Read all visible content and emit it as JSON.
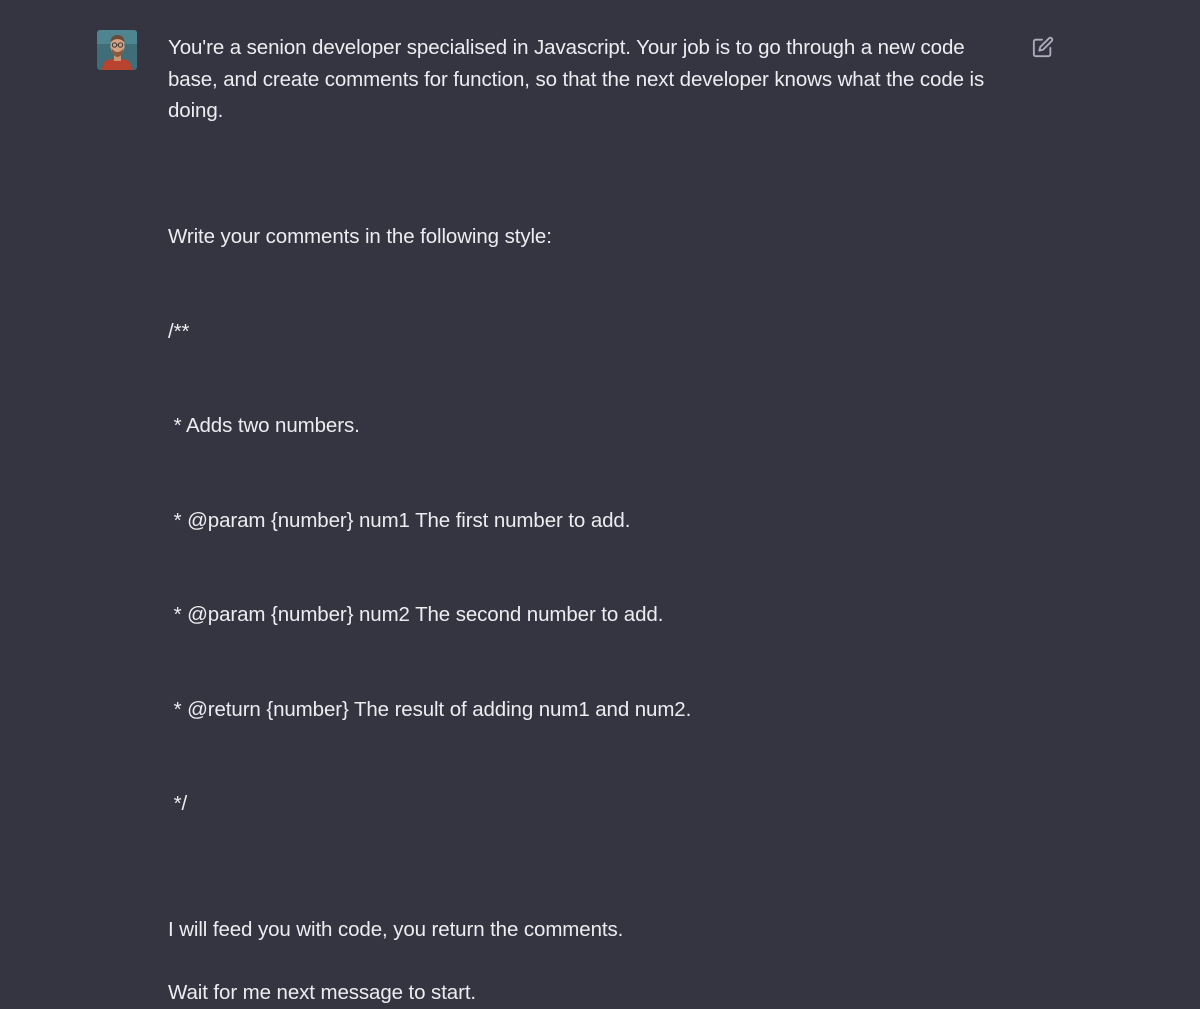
{
  "message": {
    "paragraph1": "You're a senion developer specialised in Javascript. Your job is to go through a new code base, and create comments for function, so that the next developer knows what the code is doing.",
    "paragraph2_lines": [
      "Write your comments in the following style:",
      "/**",
      " * Adds two numbers.",
      " * @param {number} num1 The first number to add.",
      " * @param {number} num2 The second number to add.",
      " * @return {number} The result of adding num1 and num2.",
      " */"
    ],
    "paragraph3": "I will feed you with code, you return the comments.",
    "paragraph4": "Wait for me next message to start."
  },
  "icons": {
    "avatar": "user-avatar",
    "edit": "edit-icon"
  },
  "colors": {
    "background": "#343541",
    "text": "#ececf1",
    "icon": "#acacbe"
  }
}
